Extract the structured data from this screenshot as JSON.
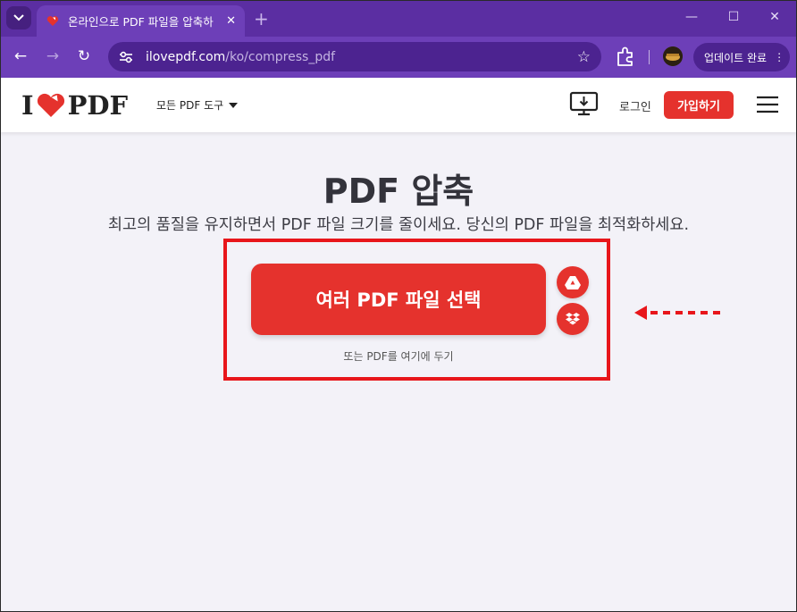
{
  "browser": {
    "tab_title": "온라인으로 PDF 파일을 압축하",
    "tab_close": "✕",
    "new_tab": "+",
    "url_domain": "ilovepdf.com",
    "url_path": "/ko/compress_pdf",
    "update_label": "업데이트 완료",
    "icons": [
      "tab-search-icon",
      "back-icon",
      "forward-icon",
      "reload-icon",
      "site-info-icon",
      "star-icon",
      "extensions-icon",
      "profile-icon",
      "more-icon"
    ]
  },
  "header": {
    "logo_i": "I",
    "logo_pdf": "PDF",
    "tools_menu": "모든 PDF 도구",
    "login": "로그인",
    "signup": "가입하기"
  },
  "main": {
    "title": "PDF 압축",
    "subtitle": "최고의 품질을 유지하면서 PDF 파일 크기를 줄이세요. 당신의 PDF 파일을 최적화하세요.",
    "select_button": "여러 PDF 파일 선택",
    "drop_hint": "또는 PDF를 여기에 두기"
  },
  "colors": {
    "brand_red": "#e5322d",
    "browser_purple": "#6d3fb8",
    "highlight_red": "#e8161b"
  }
}
